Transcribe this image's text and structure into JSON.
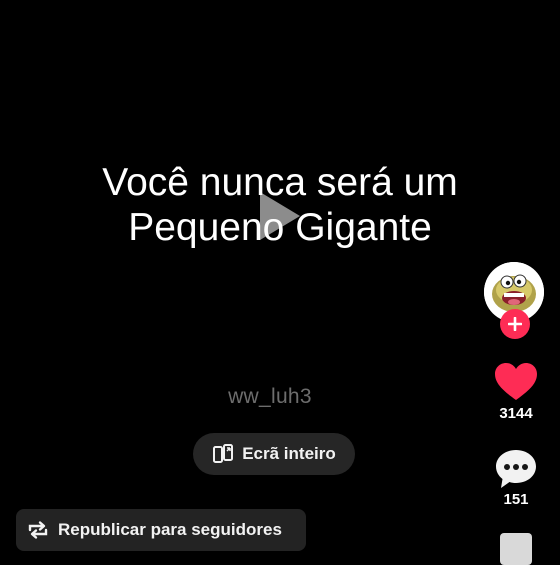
{
  "video": {
    "caption_lines": [
      "Você nunca será um",
      "Pequeno Gigante"
    ],
    "watermark": "ww_luh3"
  },
  "controls": {
    "fullscreen_label": "Ecrã inteiro",
    "repost_label": "Republicar para seguidores"
  },
  "actions": {
    "likes": "3144",
    "comments": "151"
  },
  "colors": {
    "background": "#000000",
    "accent": "#fe2c55",
    "pill": "#262626",
    "watermark": "#6d6d6d"
  },
  "icons": [
    "play-icon",
    "fullscreen-icon",
    "repost-icon",
    "plus-icon",
    "heart-icon",
    "comment-icon"
  ]
}
